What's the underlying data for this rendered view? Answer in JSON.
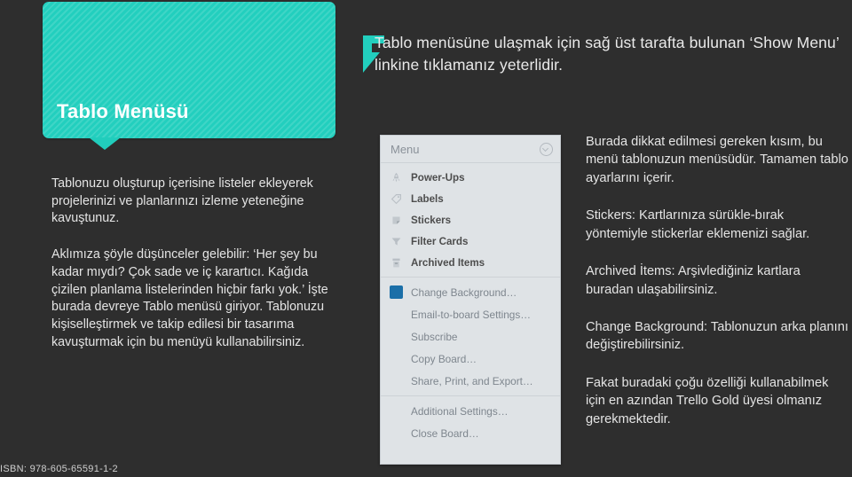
{
  "slide": {
    "background_color": "#2e2e2e",
    "accent_color": "#22cfbe"
  },
  "title_callout": {
    "text": "Tablo Menüsü",
    "color": "#22cfbe"
  },
  "header": {
    "icon": "flag-icon",
    "text": "Tablo menüsüne ulaşmak için sağ üst tarafta bulunan ‘Show Menu’ linkine tıklamanız yeterlidir."
  },
  "left_column": {
    "paragraphs": [
      "Tablonuzu oluşturup içerisine listeler ekleyerek projelerinizi ve planlarınızı izleme yeteneğine kavuştunuz.",
      "Aklımıza şöyle düşünceler gelebilir: ‘Her şey bu kadar mıydı? Çok sade ve iç karartıcı. Kağıda çizilen planlama listelerinden hiçbir farkı yok.’ İşte burada devreye Tablo menüsü giriyor. Tablonuzu kişiselleştirmek ve takip edilesi bir tasarıma kavuşturmak için bu menüyü kullanabilirsiniz."
    ]
  },
  "right_column": {
    "paragraphs": [
      "Burada dikkat edilmesi gereken kısım, bu menü tablonuzun menüsüdür. Tamamen tablo ayarlarını içerir.",
      "Stickers: Kartlarınıza sürükle-bırak yöntemiyle stickerlar eklemenizi sağlar.",
      "Archived İtems: Arşivlediğiniz kartlara buradan ulaşabilirsiniz.",
      "Change Background: Tablonuzun arka planını değiştirebilirsiniz.",
      "Fakat buradaki çoğu özelliği kullanabilmek için en azından Trello Gold üyesi olmanız gerekmektedir."
    ]
  },
  "menu_panel": {
    "header_title": "Menu",
    "collapse_icon": "chevron-down-circle-icon",
    "group_primary": [
      {
        "label": "Power-Ups",
        "icon": "rocket-icon"
      },
      {
        "label": "Labels",
        "icon": "tag-icon"
      },
      {
        "label": "Stickers",
        "icon": "sticker-icon"
      },
      {
        "label": "Filter Cards",
        "icon": "funnel-icon"
      },
      {
        "label": "Archived Items",
        "icon": "archive-box-icon"
      }
    ],
    "group_secondary": [
      {
        "label": "Change Background…",
        "icon": "color-swatch-icon",
        "swatch_color": "#1b6fa8"
      },
      {
        "label": "Email-to-board Settings…",
        "icon": "none"
      },
      {
        "label": "Subscribe",
        "icon": "none"
      },
      {
        "label": "Copy Board…",
        "icon": "none"
      },
      {
        "label": "Share, Print, and Export…",
        "icon": "none"
      }
    ],
    "group_tertiary": [
      {
        "label": "Additional Settings…",
        "icon": "none"
      },
      {
        "label": "Close Board…",
        "icon": "none"
      }
    ]
  },
  "footer": {
    "isbn": "ISBN: 978-605-65591-1-2"
  }
}
